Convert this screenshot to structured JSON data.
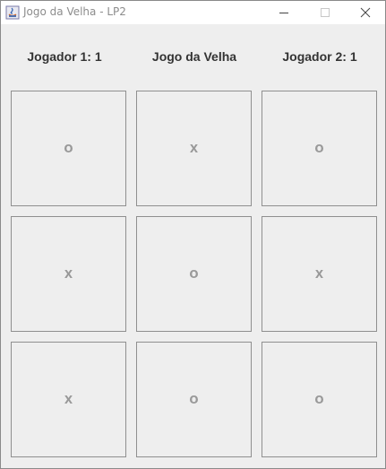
{
  "window": {
    "title": "Jogo da Velha - LP2",
    "icon": "java-icon"
  },
  "header": {
    "player1": "Jogador 1: 1",
    "title": "Jogo da Velha",
    "player2": "Jogador 2: 1"
  },
  "board": {
    "cells": [
      "O",
      "X",
      "O",
      "X",
      "O",
      "X",
      "X",
      "O",
      "O"
    ]
  }
}
